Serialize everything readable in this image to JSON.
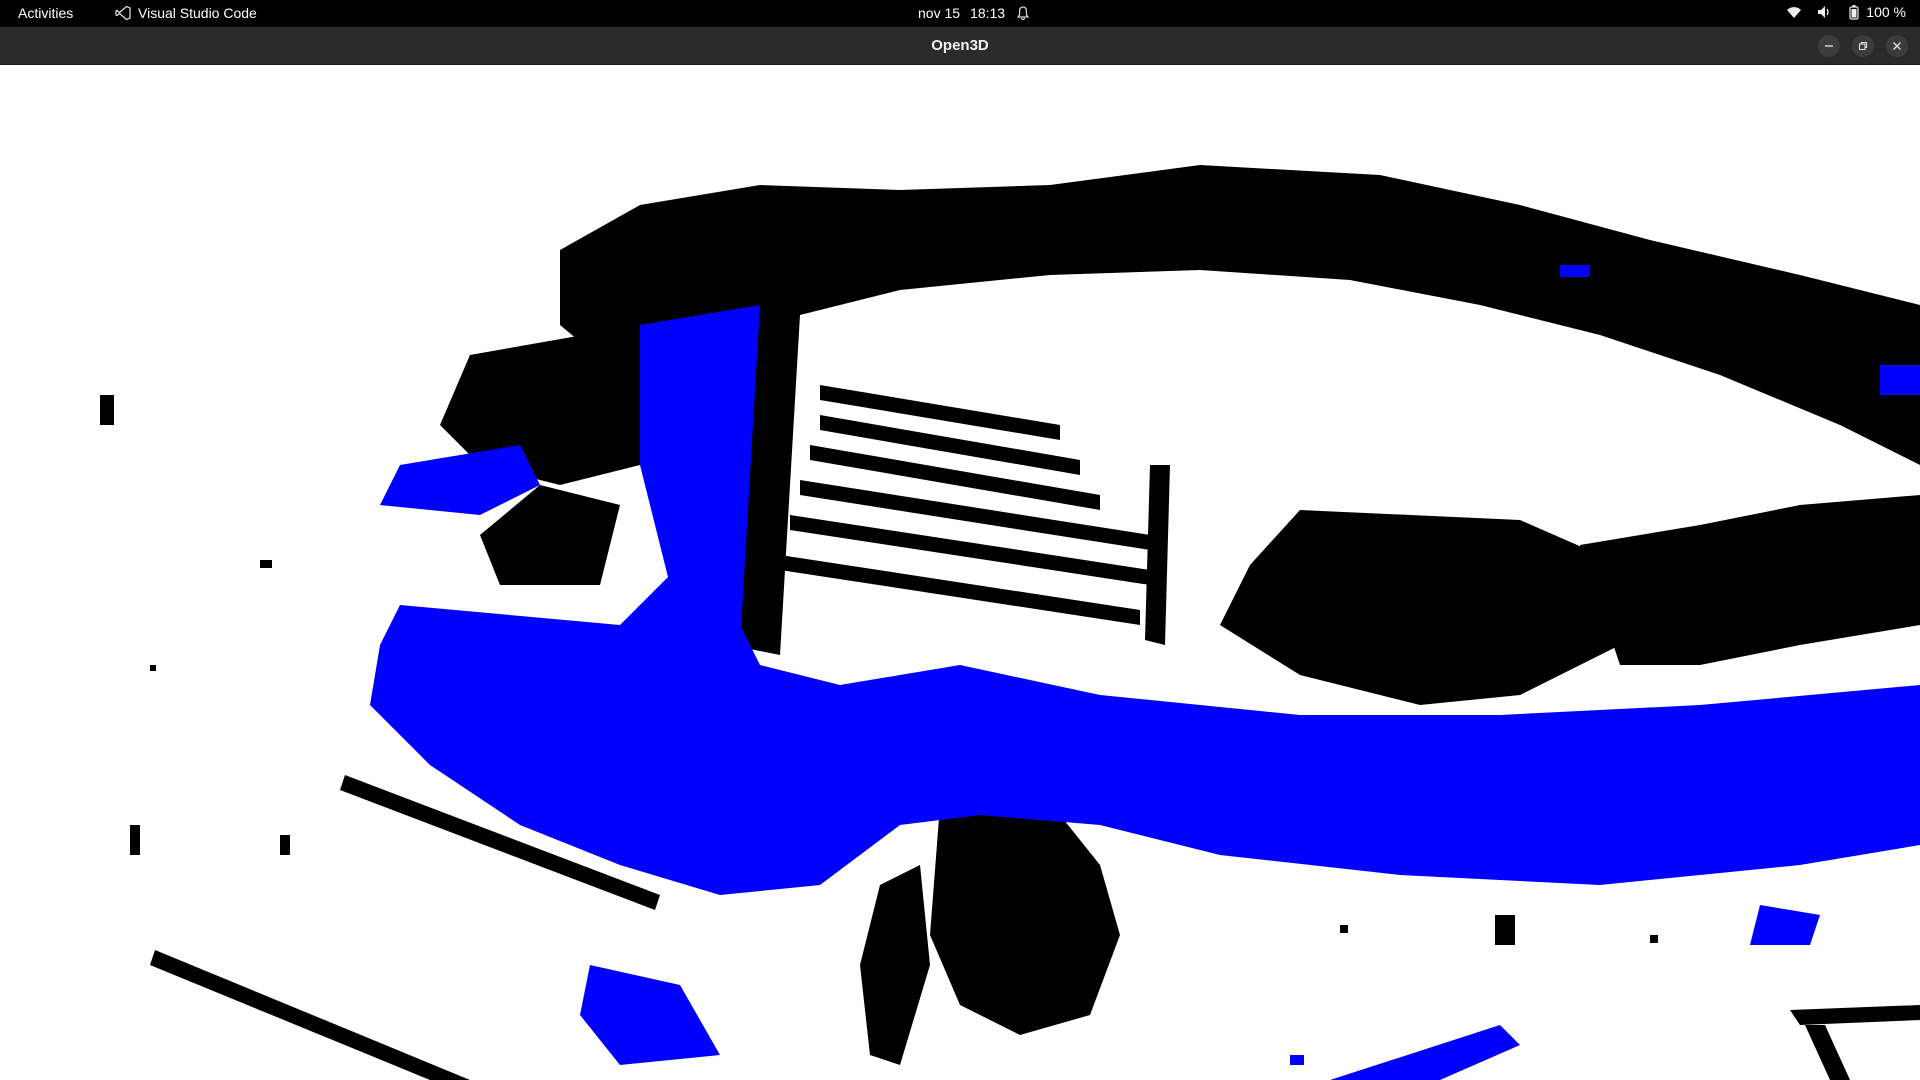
{
  "topbar": {
    "activities": "Activities",
    "app_name": "Visual Studio Code",
    "date": "nov 15",
    "time": "18:13",
    "battery": "100 %",
    "icons": [
      "vscode-icon",
      "bell-icon",
      "wifi-icon",
      "volume-icon",
      "battery-icon"
    ]
  },
  "window": {
    "title": "Open3D",
    "buttons": [
      "minimize",
      "maximize",
      "close"
    ]
  },
  "viewport": {
    "content": "point-cloud",
    "colors": {
      "background": "#ffffff",
      "points_structure": "#000000",
      "points_ground": "#0000ff"
    }
  },
  "theme": {
    "topbar_bg": "#000000",
    "titlebar_bg": "#2b2b2b",
    "text": "#ffffff"
  }
}
